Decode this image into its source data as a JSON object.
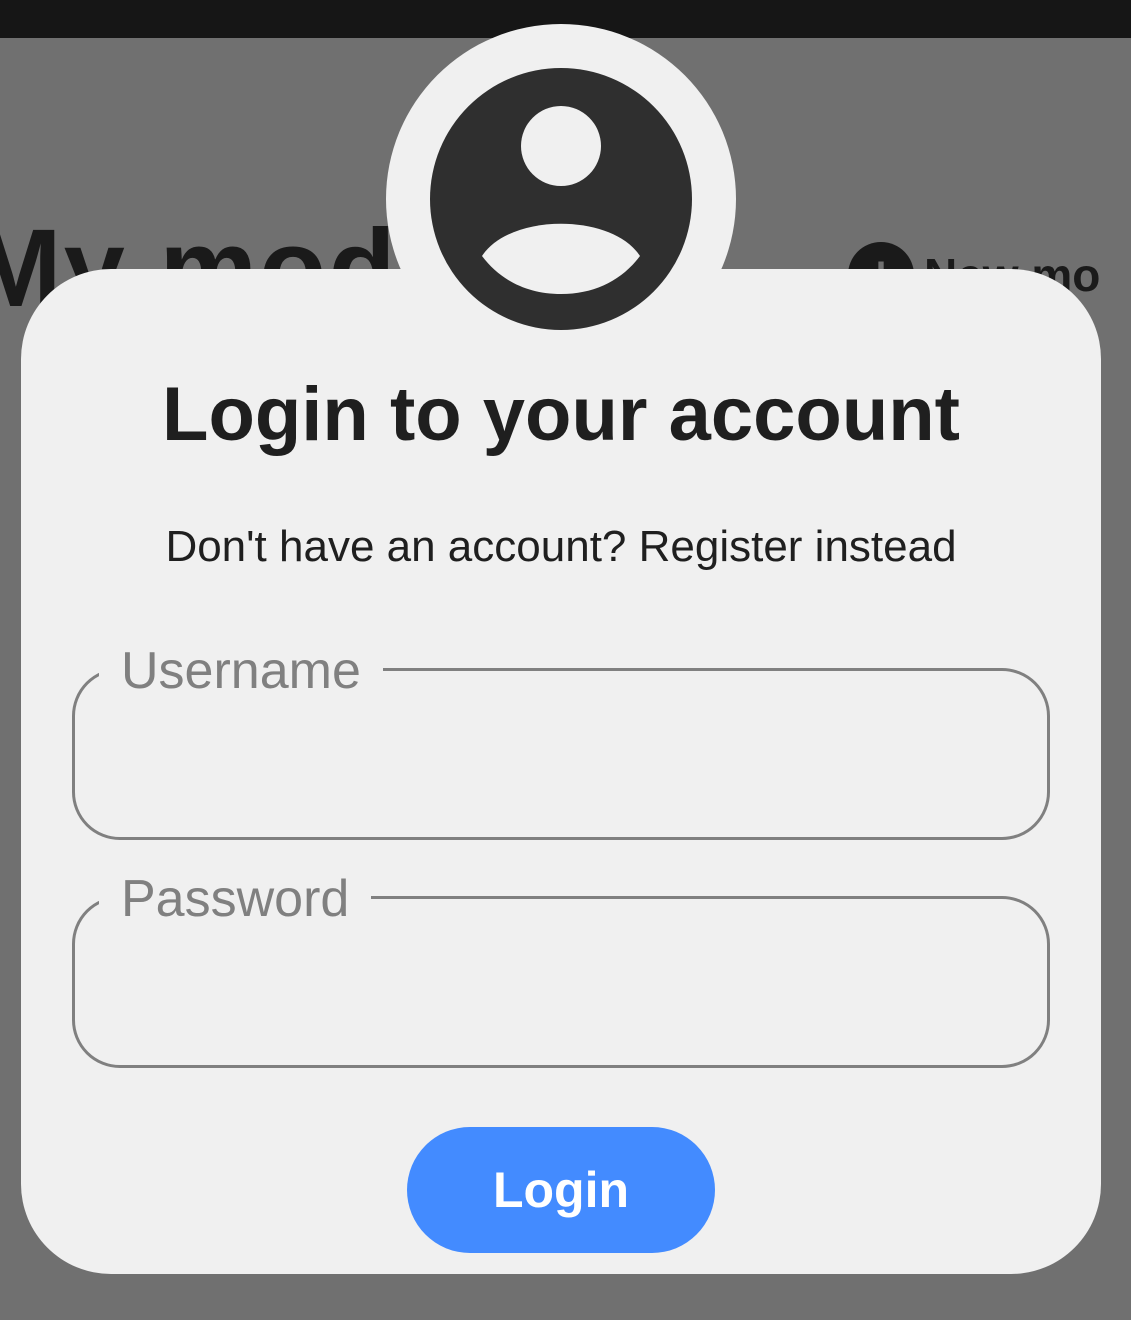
{
  "background": {
    "title_text": "My mode",
    "action_icon": "plus-icon",
    "action_label": "New mo"
  },
  "dialog": {
    "avatar_icon": "account-circle-icon",
    "title": "Login to your account",
    "register_prompt": "Don't have an account? Register instead",
    "username": {
      "label": "Username",
      "value": ""
    },
    "password": {
      "label": "Password",
      "value": ""
    },
    "login_label": "Login"
  },
  "colors": {
    "scrim": "#707070",
    "status_bar": "#161616",
    "dialog_surface": "#f0f0f0",
    "avatar": "#2f2f2f",
    "outline": "#808080",
    "primary_button": "#438bff",
    "text": "#1f1f1f"
  }
}
